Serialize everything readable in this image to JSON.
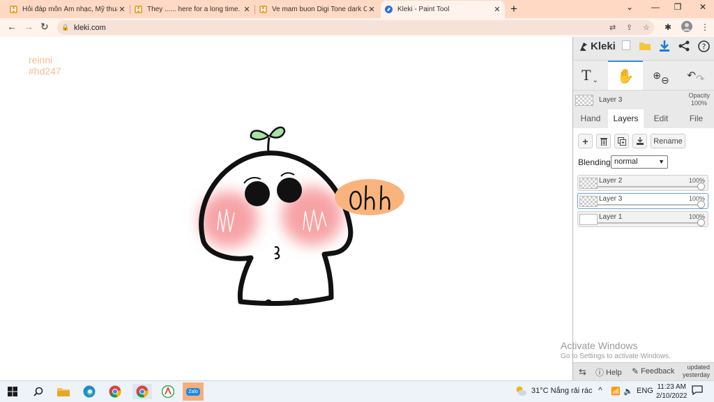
{
  "browser": {
    "tabs": [
      {
        "title": "Hỏi đáp môn Âm nhạc, Mỹ thuật,"
      },
      {
        "title": "They ...... here for a long time. * N"
      },
      {
        "title": "Ve mam buon Digi Tone dark Cs"
      },
      {
        "title": "Kleki - Paint Tool",
        "active": true
      }
    ],
    "url": "kleki.com"
  },
  "canvas": {
    "signature_line1": "reinni",
    "signature_line2": "#hd247"
  },
  "kleki": {
    "logo": "Kleki",
    "current_layer": "Layer 3",
    "opacity_label": "Opacity",
    "opacity_value": "100%",
    "tabs": [
      "Hand",
      "Layers",
      "Edit",
      "File"
    ],
    "active_tab": "Layers",
    "rename_label": "Rename",
    "blending_label": "Blending",
    "blending_value": "normal",
    "layers": [
      {
        "name": "Layer 2",
        "opacity": "100%"
      },
      {
        "name": "Layer 3",
        "opacity": "100%",
        "selected": true
      },
      {
        "name": "Layer 1",
        "opacity": "100%"
      }
    ],
    "help_label": "Help",
    "feedback_label": "Feedback",
    "updated_line1": "updated",
    "updated_line2": "yesterday"
  },
  "windows_watermark": {
    "line1": "Activate Windows",
    "line2": "Go to Settings to activate Windows."
  },
  "taskbar": {
    "zalo_label": "Zalo",
    "weather": "31°C  Nắng rải rác",
    "lang": "ENG",
    "time": "11:23 AM",
    "date": "2/10/2022"
  },
  "colors": {
    "tabbar": "#ffd9c4",
    "accent": "#3d8ee8",
    "signature": "#f6bd93",
    "speech_bubble": "#f9b47e",
    "blush": "#f7a3a6",
    "sprout": "#a6e3a4"
  }
}
